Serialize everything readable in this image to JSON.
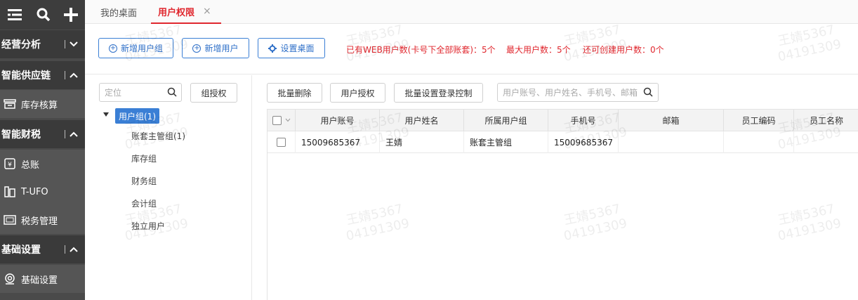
{
  "sidebar": {
    "top_icons": [
      "menu-icon",
      "search-icon",
      "plus-icon"
    ],
    "categories": [
      {
        "label": "经营分析",
        "toggle": "chevron-down"
      },
      {
        "label": "智能供应链",
        "toggle": "chevron-up"
      },
      {
        "label": "智能财税",
        "toggle": "chevron-up"
      },
      {
        "label": "基础设置",
        "toggle": "chevron-up"
      }
    ],
    "items": [
      {
        "label": "库存核算",
        "icon": "inventory-icon"
      },
      {
        "label": "总账",
        "icon": "ledger-icon"
      },
      {
        "label": "T-UFO",
        "icon": "report-icon"
      },
      {
        "label": "税务管理",
        "icon": "tax-icon"
      },
      {
        "label": "基础设置",
        "icon": "settings-icon"
      }
    ]
  },
  "tabs": [
    {
      "label": "我的桌面",
      "active": false
    },
    {
      "label": "用户权限",
      "active": true,
      "close": "×"
    }
  ],
  "toolbar": {
    "add_group_label": "新增用户组",
    "add_user_label": "新增用户",
    "set_desktop_label": "设置桌面",
    "info_web_users": "已有WEB用户数(卡号下全部账套)：5个",
    "info_max_users": "最大用户数：5个",
    "info_remaining": "还可创建用户数：0个"
  },
  "tree": {
    "search_placeholder": "定位",
    "auth_button": "组授权",
    "root": "用户组(1)",
    "children": [
      "账套主管组(1)",
      "库存组",
      "财务组",
      "会计组",
      "独立用户"
    ]
  },
  "grid": {
    "batch_delete": "批量删除",
    "user_auth": "用户授权",
    "batch_login": "批量设置登录控制",
    "search_placeholder": "用户账号、用户姓名、手机号、邮箱",
    "columns": [
      "用户账号",
      "用户姓名",
      "所属用户组",
      "手机号",
      "邮箱",
      "员工编码",
      "员工名称"
    ],
    "rows": [
      {
        "account": "15009685367",
        "name": "王婧",
        "group": "账套主管组",
        "phone": "15009685367",
        "email": "",
        "emp_code": "",
        "emp_name": ""
      }
    ]
  },
  "watermark": {
    "line1": "王婧5367",
    "line2": "04191309"
  },
  "colors": {
    "accent_red": "#e0272e",
    "accent_blue": "#3a7fd5",
    "sidebar": "#4a4a4a"
  }
}
